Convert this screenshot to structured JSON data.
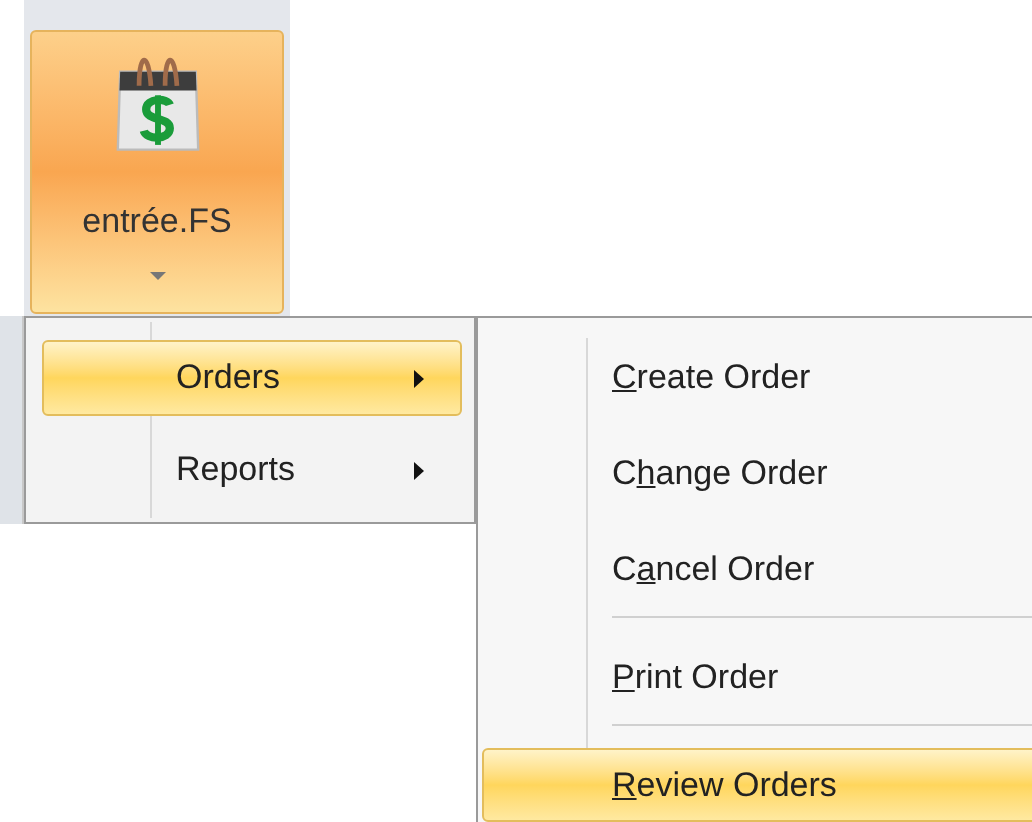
{
  "ribbon_button": {
    "label": "entrée.FS",
    "selected": true
  },
  "menu": {
    "items": [
      {
        "label": "Orders",
        "selected": true
      },
      {
        "label": "Reports",
        "selected": false
      }
    ]
  },
  "submenu": {
    "items": [
      {
        "kind": "item",
        "access_key": "C",
        "text_after": "reate Order",
        "selected": false
      },
      {
        "kind": "item",
        "text_before": "C",
        "access_key": "h",
        "text_after": "ange Order",
        "selected": false
      },
      {
        "kind": "item",
        "text_before": "C",
        "access_key": "a",
        "text_after": "ncel Order",
        "selected": false
      },
      {
        "kind": "separator"
      },
      {
        "kind": "item",
        "access_key": "P",
        "text_after": "rint Order",
        "selected": false
      },
      {
        "kind": "separator"
      },
      {
        "kind": "item",
        "access_key": "R",
        "text_after": "eview Orders",
        "selected": true
      }
    ]
  }
}
